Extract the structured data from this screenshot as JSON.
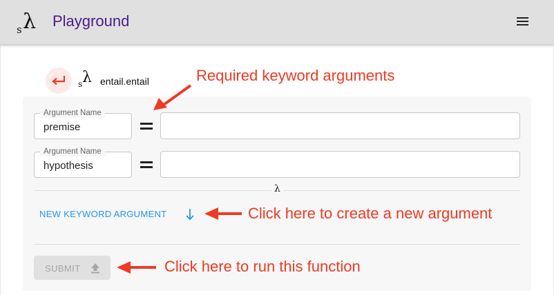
{
  "app": {
    "logo_sub": "s",
    "logo_main": "λ",
    "title": "Playground",
    "menu_icon": "hamburger-menu-icon"
  },
  "function": {
    "back_icon": "return-arrow-icon",
    "logo_sub": "s",
    "logo_main": "λ",
    "name": "entail.entail"
  },
  "arguments": [
    {
      "legend": "Argument Name",
      "name": "premise",
      "equals": "=",
      "value": ""
    },
    {
      "legend": "Argument Name",
      "name": "hypothesis",
      "equals": "=",
      "value": ""
    }
  ],
  "separator_symbol": "λ",
  "new_keyword_argument": {
    "label": "NEW KEYWORD ARGUMENT",
    "icon": "arrow-down-icon"
  },
  "submit": {
    "label": "SUBMIT",
    "icon": "upload-icon",
    "enabled": false
  },
  "annotations": {
    "required": "Required keyword arguments",
    "new_argument": "Click here to create a new argument",
    "run": "Click here to run this function"
  },
  "colors": {
    "accent": "#2196f3",
    "annotation": "#ee3a24",
    "title": "#4b1c8e",
    "appbar": "#e0e0e0"
  }
}
